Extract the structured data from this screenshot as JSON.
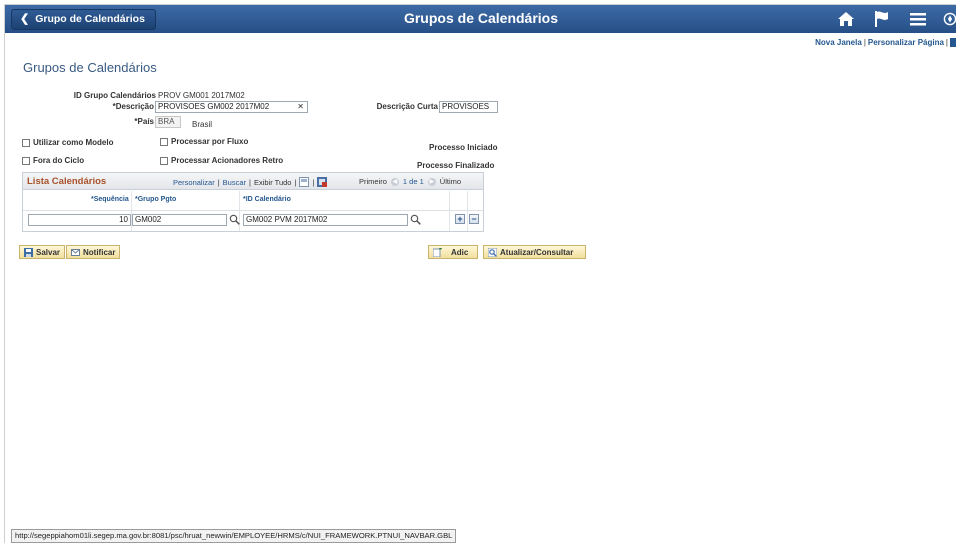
{
  "header": {
    "back_label": "Grupo de Calendários",
    "title": "Grupos de Calendários",
    "colors": {
      "banner": "#2f5b95",
      "accent_link": "#24578f",
      "grid_title": "#a8512a"
    }
  },
  "links": {
    "new_window": "Nova Janela",
    "personalize_page": "Personalizar Página",
    "separator": "|"
  },
  "page_title": "Grupos de Calendários",
  "form": {
    "group_id_label": "ID Grupo Calendários",
    "group_id_value": "PROV GM001 2017M02",
    "description_label": "*Descrição",
    "description_value": "PROVISOES GM002 2017M02",
    "short_desc_label": "Descrição Curta",
    "short_desc_value": "PROVISOES",
    "country_label": "*País",
    "country_value": "BRA",
    "country_name": "Brasil",
    "use_as_model": "Utilizar como Modelo",
    "process_by_flow": "Processar por Fluxo",
    "out_of_cycle": "Fora do Ciclo",
    "process_retro": "Processar Acionadores Retro",
    "process_started": "Processo Iniciado",
    "process_finished": "Processo Finalizado"
  },
  "grid": {
    "title": "Lista Calendários",
    "personalize": "Personalizar",
    "search": "Buscar",
    "show_all": "Exibir Tudo",
    "first": "Primeiro",
    "count": "1 de 1",
    "last": "Último",
    "columns": [
      "*Sequência",
      "*Grupo Pgto",
      "*ID Calendário"
    ],
    "rows": [
      {
        "sequence": "10",
        "pay_group": "GM002",
        "calendar_id": "GM002 PVM 2017M02"
      }
    ]
  },
  "buttons": {
    "save": "Salvar",
    "notify": "Notificar",
    "add": "Adic",
    "update": "Atualizar/Consultar"
  },
  "statusbar": "http://segeppiahom01li.segep.ma.gov.br:8081/psc/hruat_newwin/EMPLOYEE/HRMS/c/NUI_FRAMEWORK.PTNUI_NAVBAR.GBL",
  "icons": [
    "chevron-left-icon",
    "home-icon",
    "flag-icon",
    "menu-icon",
    "compass-icon",
    "search-icon",
    "clear-icon",
    "zoom-icon",
    "download-icon",
    "add-row-icon",
    "delete-row-icon",
    "save-icon",
    "notify-icon",
    "add-icon",
    "update-icon"
  ]
}
